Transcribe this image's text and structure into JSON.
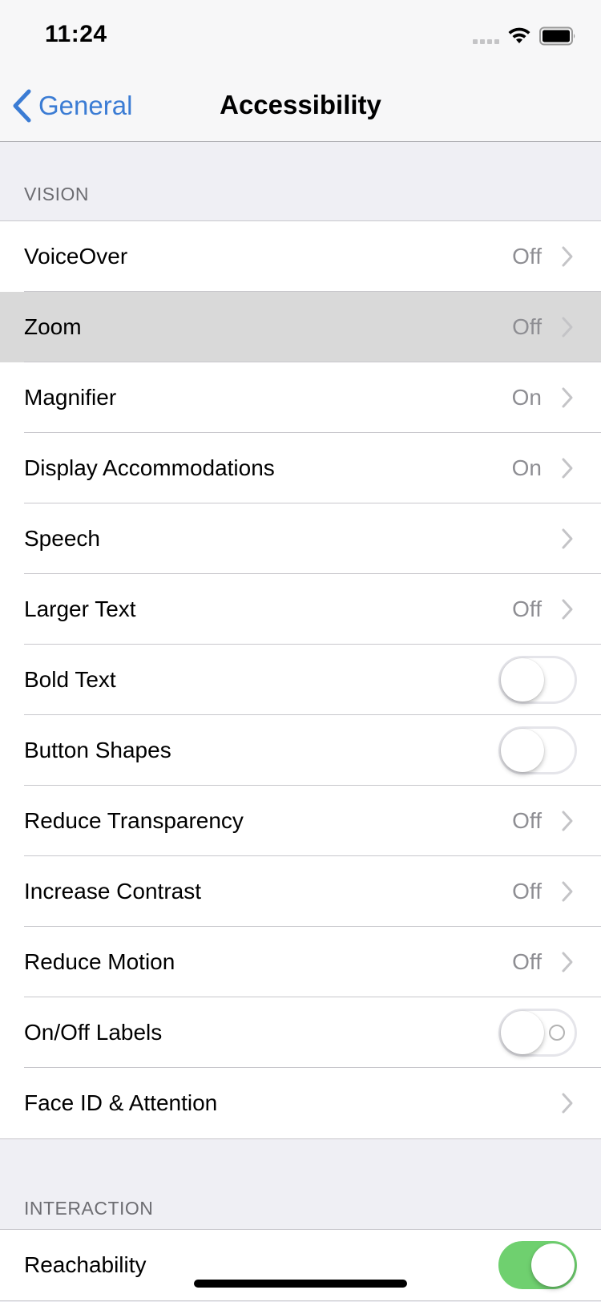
{
  "status_bar": {
    "time": "11:24",
    "icons": [
      "signal-dots-icon",
      "wifi-icon",
      "battery-icon"
    ]
  },
  "nav": {
    "back_label": "General",
    "back_icon": "chevron-left-icon",
    "title": "Accessibility",
    "accent_color": "#3b7cd4"
  },
  "sections": [
    {
      "header": "VISION",
      "rows": [
        {
          "label": "VoiceOver",
          "value": "Off",
          "type": "disclosure"
        },
        {
          "label": "Zoom",
          "value": "Off",
          "type": "disclosure",
          "highlighted": true
        },
        {
          "label": "Magnifier",
          "value": "On",
          "type": "disclosure"
        },
        {
          "label": "Display Accommodations",
          "value": "On",
          "type": "disclosure"
        },
        {
          "label": "Speech",
          "value": "",
          "type": "disclosure"
        },
        {
          "label": "Larger Text",
          "value": "Off",
          "type": "disclosure"
        },
        {
          "label": "Bold Text",
          "type": "toggle",
          "on": false
        },
        {
          "label": "Button Shapes",
          "type": "toggle",
          "on": false
        },
        {
          "label": "Reduce Transparency",
          "value": "Off",
          "type": "disclosure"
        },
        {
          "label": "Increase Contrast",
          "value": "Off",
          "type": "disclosure"
        },
        {
          "label": "Reduce Motion",
          "value": "Off",
          "type": "disclosure"
        },
        {
          "label": "On/Off Labels",
          "type": "toggle",
          "on": false,
          "shows_off_label": true
        },
        {
          "label": "Face ID & Attention",
          "value": "",
          "type": "disclosure"
        }
      ]
    },
    {
      "header": "INTERACTION",
      "rows": [
        {
          "label": "Reachability",
          "type": "toggle",
          "on": true
        }
      ]
    }
  ],
  "colors": {
    "toggle_on": "#6fd06f",
    "secondary_text": "#8e8e93",
    "highlight_row": "#d9d9d9"
  }
}
